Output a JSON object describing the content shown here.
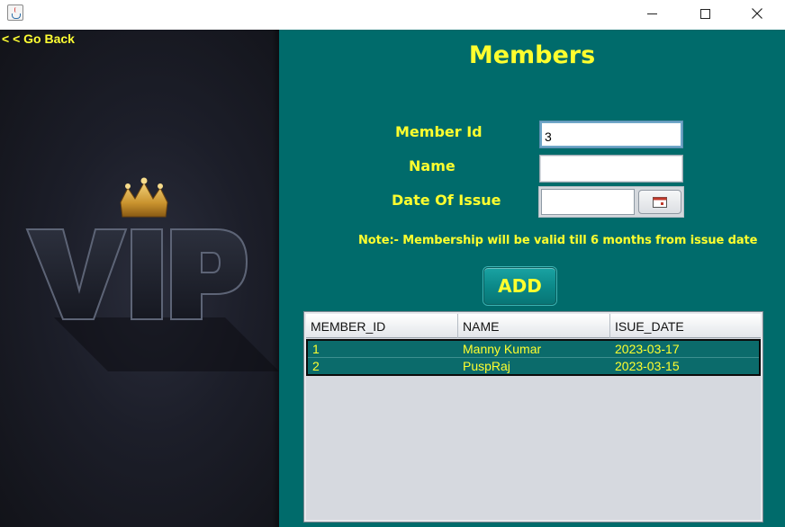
{
  "window": {
    "title": ""
  },
  "nav": {
    "go_back": "< < Go Back"
  },
  "page": {
    "title": "Members"
  },
  "form": {
    "member_id_label": "Member Id",
    "member_id_value": "3",
    "name_label": "Name",
    "name_value": "",
    "date_label": "Date Of Issue",
    "date_value": ""
  },
  "note": "Note:-  Membership will be valid till 6 months from issue date",
  "add_button": "ADD",
  "table": {
    "headers": [
      "MEMBER_ID",
      "NAME",
      "ISUE_DATE"
    ],
    "rows": [
      [
        "1",
        "Manny Kumar",
        "2023-03-17"
      ],
      [
        "2",
        "PuspRaj",
        "2023-03-15"
      ]
    ]
  },
  "artwork": {
    "text": "VIP"
  },
  "icons": {
    "app": "java-cup-icon",
    "calendar": "calendar-icon",
    "minimize": "minimize-icon",
    "maximize": "maximize-icon",
    "close": "close-icon",
    "crown": "crown-icon"
  },
  "colors": {
    "accent_text": "#ffff2e",
    "panel_bg": "#006b6b",
    "row_bg": "#0b6b6b",
    "left_bg": "#1c1e29"
  }
}
